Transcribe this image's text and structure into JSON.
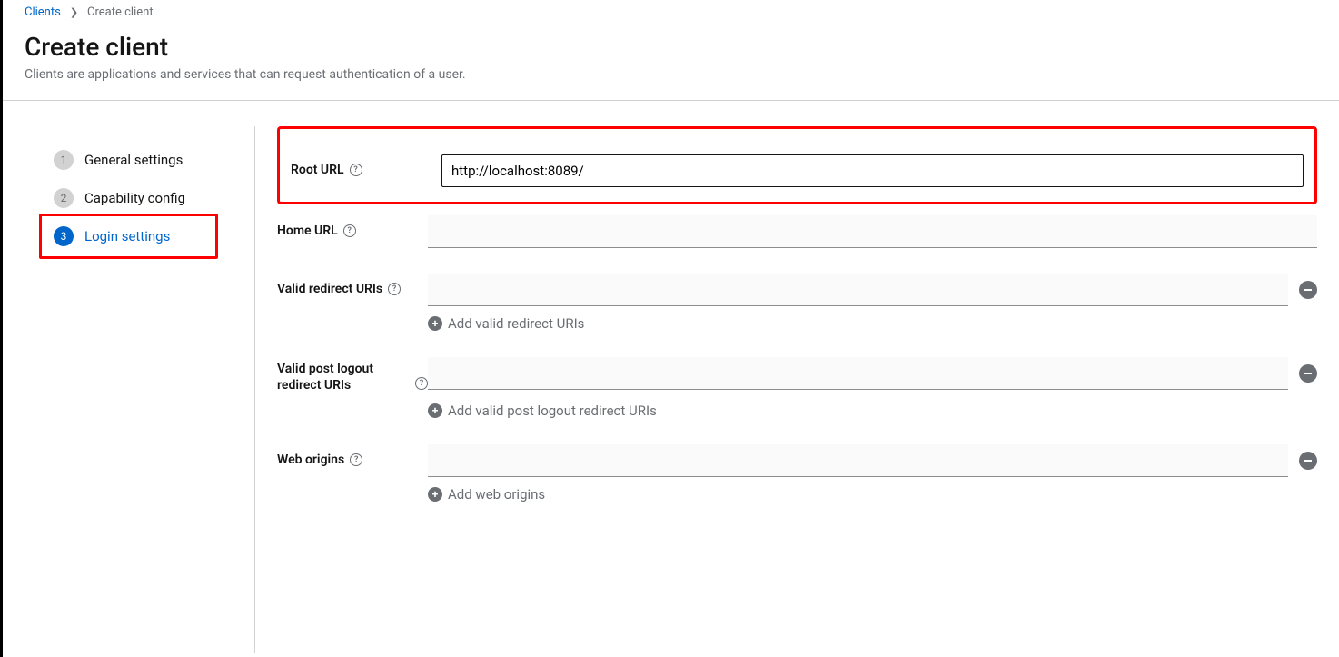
{
  "breadcrumb": {
    "parent": "Clients",
    "current": "Create client"
  },
  "header": {
    "title": "Create client",
    "subtitle": "Clients are applications and services that can request authentication of a user."
  },
  "wizard": {
    "steps": [
      {
        "num": "1",
        "label": "General settings"
      },
      {
        "num": "2",
        "label": "Capability config"
      },
      {
        "num": "3",
        "label": "Login settings"
      }
    ]
  },
  "form": {
    "rootUrl": {
      "label": "Root URL",
      "value": "http://localhost:8089/"
    },
    "homeUrl": {
      "label": "Home URL",
      "value": ""
    },
    "redirectUris": {
      "label": "Valid redirect URIs",
      "value": "",
      "addLabel": "Add valid redirect URIs"
    },
    "postLogoutUris": {
      "label": "Valid post logout redirect URIs",
      "value": "",
      "addLabel": "Add valid post logout redirect URIs"
    },
    "webOrigins": {
      "label": "Web origins",
      "value": "",
      "addLabel": "Add web origins"
    }
  }
}
